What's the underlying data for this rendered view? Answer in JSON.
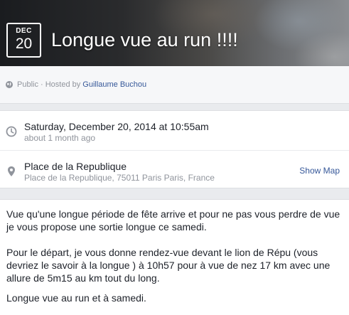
{
  "event": {
    "month": "DEC",
    "day": "20",
    "title": "Longue vue au run !!!!"
  },
  "privacy": {
    "text": "Public · Hosted by",
    "host": "Guillaume Buchou"
  },
  "details": {
    "datetime": "Saturday, December 20, 2014 at 10:55am",
    "relative_time": "about 1 month ago",
    "place_name": "Place de la Republique",
    "place_address": "Place de la Republique, 75011 Paris Paris, France",
    "show_map_label": "Show Map"
  },
  "description": {
    "paragraph_1": "Vue qu'une longue période de fête arrive et pour ne pas vous perdre de vue je vous propose une sortie longue ce samedi.",
    "paragraph_2": "Pour le départ, je vous donne rendez-vue devant le lion de Répu (vous devriez le savoir à la longue ) à 10h57 pour à vue de nez 17 km avec une allure de 5m15 au km tout du long.",
    "paragraph_3": "Longue vue au run et à samedi."
  },
  "icons": {
    "globe": "globe-icon",
    "clock": "clock-icon",
    "location": "location-pin-icon"
  }
}
